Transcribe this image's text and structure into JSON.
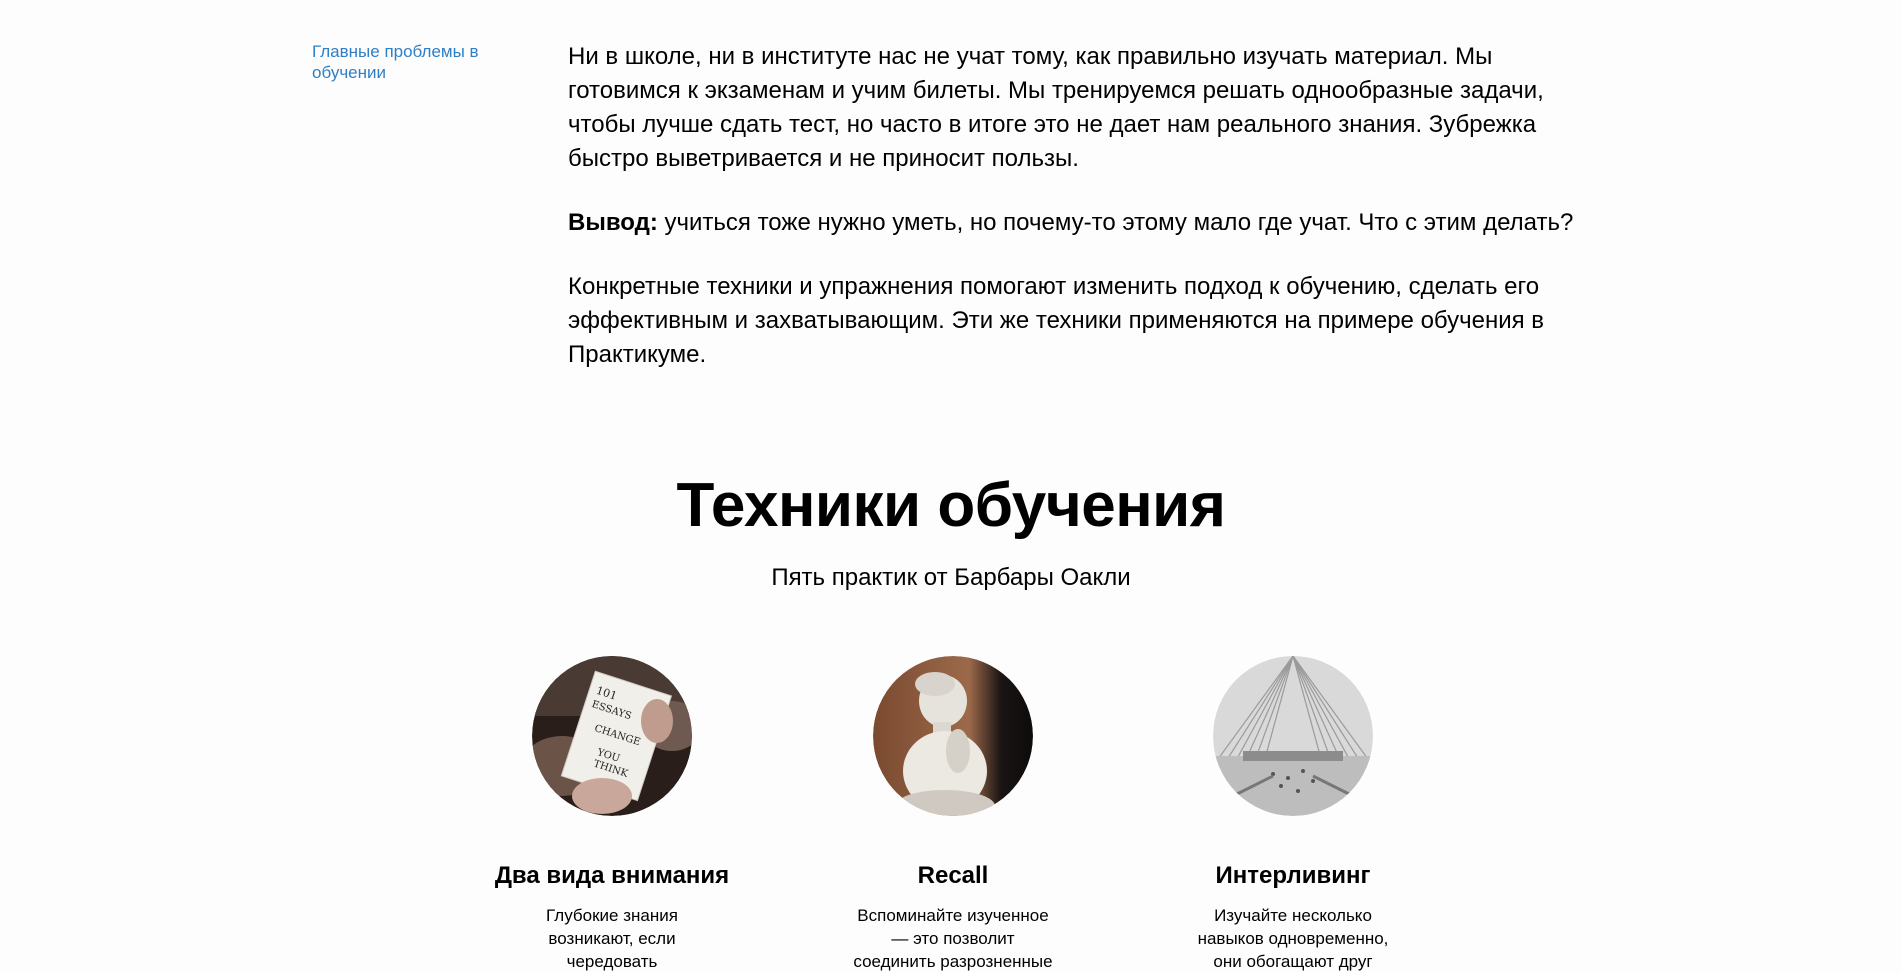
{
  "sidebar": {
    "link_label": "Главные проблемы в обучении"
  },
  "article": {
    "paragraph_1": "Ни в школе, ни в институте нас не учат тому, как правильно изучать материал. Мы готовимся к экзаменам и учим билеты. Мы тренируемся решать однообразные задачи, чтобы лучше сдать тест, но часто в итоге это не дает нам реального знания. Зубрежка быстро выветривается и не приносит пользы.",
    "conclusion_label": "Вывод:",
    "conclusion_text": " учиться тоже нужно уметь, но почему-то этому мало где учат. Что с этим делать?",
    "paragraph_3": "Конкретные техники и упражнения помогают изменить подход к обучению, сделать его эффективным и захватывающим. Эти же техники применяются на примере обучения в Практикуме."
  },
  "techniques": {
    "title": "Техники обучения",
    "subtitle": "Пять практик от Барбары Оакли",
    "cards": [
      {
        "title": "Два вида внимания",
        "text": "Глубокие знания возникают, если чередовать сфокусированное и",
        "image": "book-photo"
      },
      {
        "title": "Recall",
        "text": "Вспоминайте изученное — это позволит соединить разрозненные порции",
        "image": "statue-photo"
      },
      {
        "title": "Интерливинг",
        "text": "Изучайте несколько навыков одновременно, они обогащают друг друга.",
        "image": "architecture-photo"
      }
    ]
  },
  "colors": {
    "link": "#2f7fc6",
    "background": "#fdfdfd",
    "text": "#000000"
  }
}
